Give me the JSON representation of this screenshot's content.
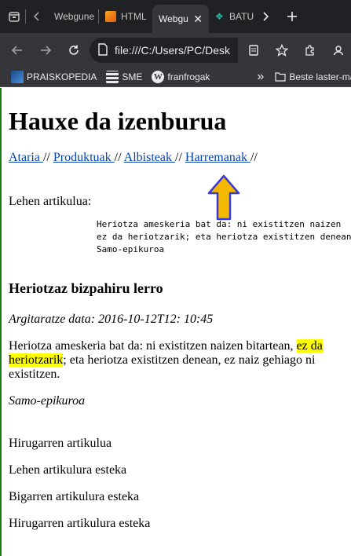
{
  "browser": {
    "tabs": [
      {
        "title": "Webgune",
        "active": false
      },
      {
        "title": "HTML",
        "active": false
      },
      {
        "title": "Webgu",
        "active": true
      },
      {
        "title": "BATU",
        "active": false
      }
    ],
    "address": "file:///C:/Users/PC/Desk",
    "bookmarks": [
      {
        "label": "PRAISKOPEDIA",
        "icon": "praiskopedia-icon"
      },
      {
        "label": "SME",
        "icon": "sme-icon"
      },
      {
        "label": "franfrogak",
        "icon": "wordpress-icon"
      }
    ],
    "bookmarks_overflow": "»",
    "other_bookmarks": "Beste laster-mar"
  },
  "page": {
    "title": "Hauxe da izenburua",
    "nav": [
      {
        "label": "Ataria "
      },
      {
        "label": "Produktuak "
      },
      {
        "label": "Albisteak "
      },
      {
        "label": "Harremanak "
      }
    ],
    "nav_separator": " // ",
    "nav_trailing": " //",
    "first_article_label": "Lehen artikulua:",
    "preformatted": "Heriotza ameskeria bat da: ni existitzen naizen\nez da heriotzarik; eta heriotza existitzen denean\nSamo-epikuroa",
    "section_heading": "Heriotzaz bizpahiru lerro",
    "date_line": "Argitaratze data: 2016-10-12T12: 10:45",
    "paragraph": {
      "before": "Heriotza ameskeria bat da: ni existitzen naizen bitartean, ",
      "highlight": "ez da heriotzarik",
      "after": "; eta heriotza existitzen denean, ez naiz gehiago ni existitzen."
    },
    "author": "Samo-epikuroa",
    "third_article": "Hirugarren artikulua",
    "links": [
      "Lehen artikulura esteka",
      "Bigarren artikulura esteka",
      "Hirugarren artikulura esteka"
    ],
    "annotation_arrow_color": "#f5b800",
    "annotation_arrow_stroke": "#3a3ad6",
    "highlight_color": "#ffff00"
  }
}
